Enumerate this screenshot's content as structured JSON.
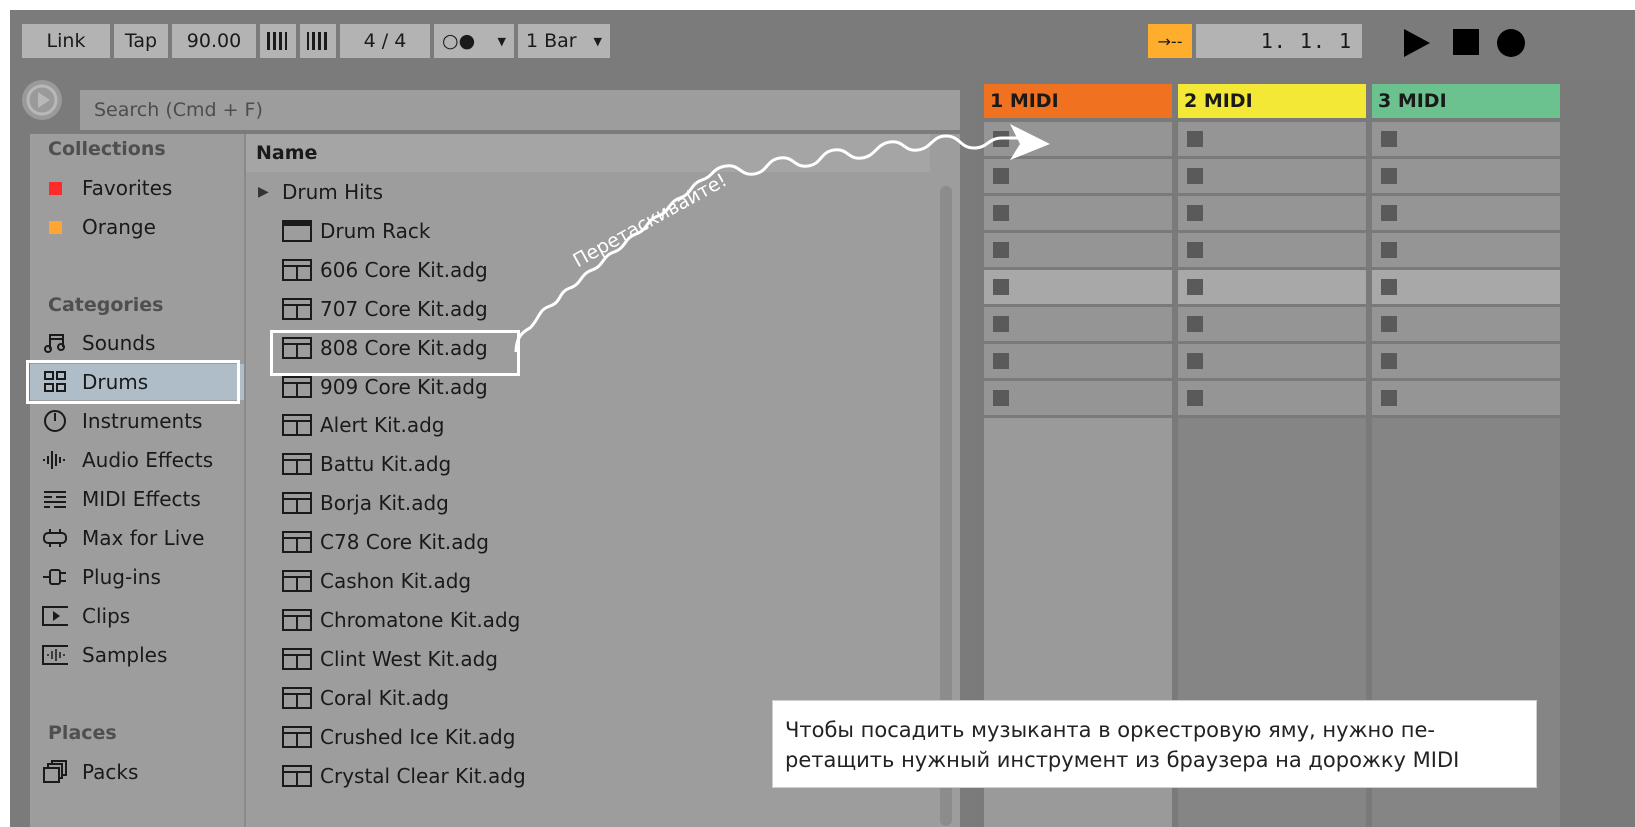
{
  "transport": {
    "link": "Link",
    "tap": "Tap",
    "tempo": "90.00",
    "time_signature": "4 / 4",
    "metronome_symbol": "○●",
    "quantize": "1 Bar",
    "follow_symbol": "→--",
    "position": "1.  1.  1"
  },
  "browser": {
    "search_placeholder": "Search (Cmd + F)",
    "collections_title": "Collections",
    "collections": [
      {
        "label": "Favorites",
        "color": "#ff2a2a"
      },
      {
        "label": "Orange",
        "color": "#ffa531"
      }
    ],
    "categories_title": "Categories",
    "categories": [
      {
        "label": "Sounds",
        "icon": "music-note-icon"
      },
      {
        "label": "Drums",
        "icon": "drum-grid-icon"
      },
      {
        "label": "Instruments",
        "icon": "instrument-knob-icon"
      },
      {
        "label": "Audio Effects",
        "icon": "waveform-icon"
      },
      {
        "label": "MIDI Effects",
        "icon": "midi-lines-icon"
      },
      {
        "label": "Max for Live",
        "icon": "max-for-live-icon"
      },
      {
        "label": "Plug-ins",
        "icon": "plug-icon"
      },
      {
        "label": "Clips",
        "icon": "clip-play-icon"
      },
      {
        "label": "Samples",
        "icon": "sample-wave-icon"
      }
    ],
    "selected_category": "Drums",
    "places_title": "Places",
    "places": [
      {
        "label": "Packs",
        "icon": "packs-icon"
      }
    ],
    "list_header": "Name",
    "items": [
      {
        "label": "Drum Hits",
        "type": "folder"
      },
      {
        "label": "Drum Rack",
        "type": "rack"
      },
      {
        "label": "606 Core Kit.adg",
        "type": "kit"
      },
      {
        "label": "707 Core Kit.adg",
        "type": "kit"
      },
      {
        "label": "808 Core Kit.adg",
        "type": "kit"
      },
      {
        "label": "909 Core Kit.adg",
        "type": "kit"
      },
      {
        "label": "Alert Kit.adg",
        "type": "kit"
      },
      {
        "label": "Battu Kit.adg",
        "type": "kit"
      },
      {
        "label": "Borja Kit.adg",
        "type": "kit"
      },
      {
        "label": "C78 Core Kit.adg",
        "type": "kit"
      },
      {
        "label": "Cashon Kit.adg",
        "type": "kit"
      },
      {
        "label": "Chromatone Kit.adg",
        "type": "kit"
      },
      {
        "label": "Clint West Kit.adg",
        "type": "kit"
      },
      {
        "label": "Coral Kit.adg",
        "type": "kit"
      },
      {
        "label": "Crushed Ice Kit.adg",
        "type": "kit"
      },
      {
        "label": "Crystal Clear Kit.adg",
        "type": "kit"
      }
    ]
  },
  "tracks": [
    {
      "name": "1 MIDI",
      "color": "#f07220"
    },
    {
      "name": "2 MIDI",
      "color": "#f3e836"
    },
    {
      "name": "3 MIDI",
      "color": "#6cc28e"
    }
  ],
  "annotation": {
    "drag_label": "Перетаскивайте!",
    "note_line1": "Чтобы посадить музыканта в оркестровую яму, нужно пе-",
    "note_line2": "ретащить нужный инструмент из браузера на дорожку MIDI"
  }
}
